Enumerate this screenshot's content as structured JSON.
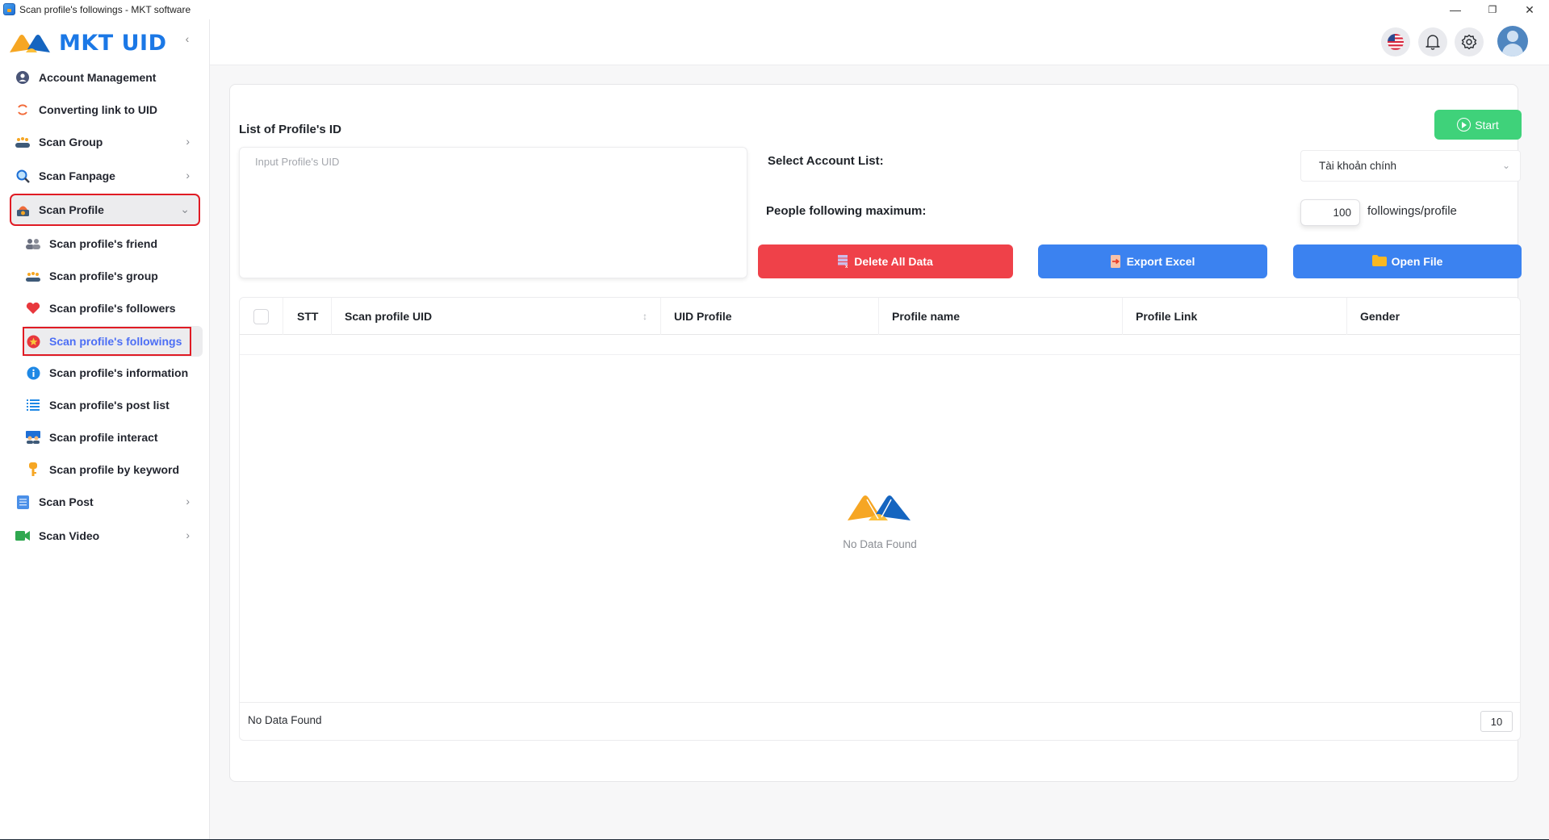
{
  "window": {
    "title": "Scan profile's followings - MKT software",
    "controls": {
      "minimize": "—",
      "restore": "❐",
      "close": "✕"
    }
  },
  "brand": {
    "name": "MKT UID",
    "collapse_icon": "‹"
  },
  "sidebar": {
    "items": [
      {
        "label": "Account Management",
        "icon": "user-circle-icon",
        "has_submenu": false
      },
      {
        "label": "Converting link to UID",
        "icon": "refresh-icon",
        "has_submenu": false
      },
      {
        "label": "Scan Group",
        "icon": "group-icon",
        "has_submenu": true
      },
      {
        "label": "Scan Fanpage",
        "icon": "magnifier-icon",
        "has_submenu": true
      },
      {
        "label": "Scan Profile",
        "icon": "profile-badge-icon",
        "has_submenu": true,
        "expanded": true
      },
      {
        "label": "Scan Post",
        "icon": "document-icon",
        "has_submenu": true
      },
      {
        "label": "Scan Video",
        "icon": "video-camera-icon",
        "has_submenu": true
      }
    ],
    "scan_profile_submenu": [
      {
        "label": "Scan profile's friend",
        "icon": "friends-icon"
      },
      {
        "label": "Scan profile's group",
        "icon": "group-icon"
      },
      {
        "label": "Scan profile's followers",
        "icon": "heart-icon"
      },
      {
        "label": "Scan profile's followings",
        "icon": "star-badge-icon",
        "active": true
      },
      {
        "label": "Scan profile's information",
        "icon": "info-icon"
      },
      {
        "label": "Scan profile's post list",
        "icon": "list-icon"
      },
      {
        "label": "Scan profile interact",
        "icon": "interact-icon"
      },
      {
        "label": "Scan profile by keyword",
        "icon": "key-icon"
      }
    ],
    "chevron_right": "›",
    "chevron_down": "⌄"
  },
  "header": {
    "language_icon": "us-flag-icon",
    "notification_icon": "bell-icon",
    "settings_icon": "gear-icon",
    "avatar_icon": "user-avatar-icon"
  },
  "form": {
    "section_title": "List of Profile's ID",
    "uid_input": {
      "placeholder": "Input Profile's UID",
      "value": ""
    },
    "start_label": "Start",
    "select_account_label": "Select Account List:",
    "select_account_value": "Tài khoản chính",
    "max_label": "People following maximum:",
    "max_value": "100",
    "max_unit": "followings/profile",
    "buttons": {
      "delete": "Delete All Data",
      "export": "Export Excel",
      "open": "Open File"
    },
    "colors": {
      "start": "#3fd27a",
      "delete": "#ef4149",
      "primary": "#3b82f0",
      "active_nav": "#4c6ef5",
      "highlight_box": "#e01b24"
    }
  },
  "table": {
    "columns": [
      "STT",
      "Scan profile UID",
      "UID Profile",
      "Profile name",
      "Profile Link",
      "Gender"
    ],
    "rows": [],
    "empty_text": "No Data Found",
    "footer_text": "No Data Found",
    "page_size": "10",
    "sort_icon": "↕"
  }
}
